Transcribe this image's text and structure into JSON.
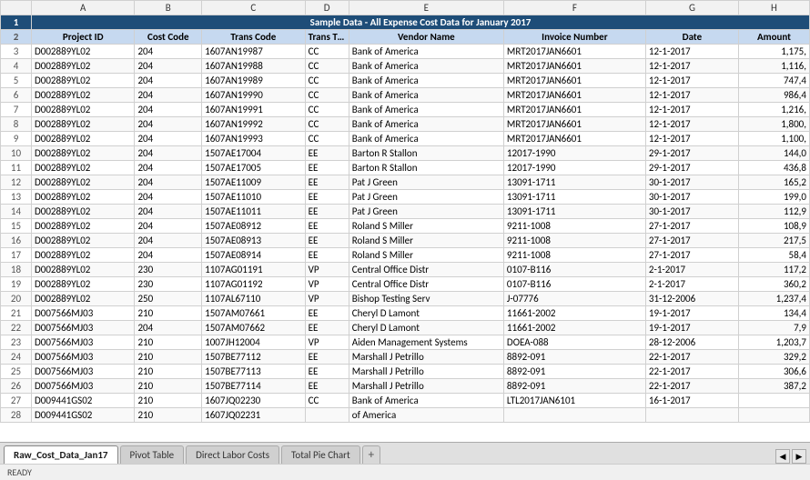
{
  "title": "Sample Data - All Expense Cost Data for January 2017",
  "columns": {
    "row_num": "#",
    "A": "A",
    "B": "B",
    "C": "C",
    "D": "D",
    "E": "E",
    "F": "F",
    "G": "G",
    "H": "H"
  },
  "headers": {
    "A": "Project ID",
    "B": "Cost Code",
    "C": "Trans Code",
    "D": "Trans Type",
    "E": "Vendor Name",
    "F": "Invoice Number",
    "G": "Date",
    "H": "Amount"
  },
  "rows": [
    {
      "row": 3,
      "A": "D002889YL02",
      "B": "204",
      "C": "1607AN19987",
      "D": "CC",
      "E": "Bank of America",
      "F": "MRT2017JAN6601",
      "G": "12-1-2017",
      "H": "1,175,"
    },
    {
      "row": 4,
      "A": "D002889YL02",
      "B": "204",
      "C": "1607AN19988",
      "D": "CC",
      "E": "Bank of America",
      "F": "MRT2017JAN6601",
      "G": "12-1-2017",
      "H": "1,116,"
    },
    {
      "row": 5,
      "A": "D002889YL02",
      "B": "204",
      "C": "1607AN19989",
      "D": "CC",
      "E": "Bank of America",
      "F": "MRT2017JAN6601",
      "G": "12-1-2017",
      "H": "747,4"
    },
    {
      "row": 6,
      "A": "D002889YL02",
      "B": "204",
      "C": "1607AN19990",
      "D": "CC",
      "E": "Bank of America",
      "F": "MRT2017JAN6601",
      "G": "12-1-2017",
      "H": "986,4"
    },
    {
      "row": 7,
      "A": "D002889YL02",
      "B": "204",
      "C": "1607AN19991",
      "D": "CC",
      "E": "Bank of America",
      "F": "MRT2017JAN6601",
      "G": "12-1-2017",
      "H": "1,216,"
    },
    {
      "row": 8,
      "A": "D002889YL02",
      "B": "204",
      "C": "1607AN19992",
      "D": "CC",
      "E": "Bank of America",
      "F": "MRT2017JAN6601",
      "G": "12-1-2017",
      "H": "1,800,"
    },
    {
      "row": 9,
      "A": "D002889YL02",
      "B": "204",
      "C": "1607AN19993",
      "D": "CC",
      "E": "Bank of America",
      "F": "MRT2017JAN6601",
      "G": "12-1-2017",
      "H": "1,100,"
    },
    {
      "row": 10,
      "A": "D002889YL02",
      "B": "204",
      "C": "1507AE17004",
      "D": "EE",
      "E": "Barton R Stallon",
      "F": "12017-1990",
      "G": "29-1-2017",
      "H": "144,0"
    },
    {
      "row": 11,
      "A": "D002889YL02",
      "B": "204",
      "C": "1507AE17005",
      "D": "EE",
      "E": "Barton R Stallon",
      "F": "12017-1990",
      "G": "29-1-2017",
      "H": "436,8"
    },
    {
      "row": 12,
      "A": "D002889YL02",
      "B": "204",
      "C": "1507AE11009",
      "D": "EE",
      "E": "Pat J Green",
      "F": "13091-1711",
      "G": "30-1-2017",
      "H": "165,2"
    },
    {
      "row": 13,
      "A": "D002889YL02",
      "B": "204",
      "C": "1507AE11010",
      "D": "EE",
      "E": "Pat J Green",
      "F": "13091-1711",
      "G": "30-1-2017",
      "H": "199,0"
    },
    {
      "row": 14,
      "A": "D002889YL02",
      "B": "204",
      "C": "1507AE11011",
      "D": "EE",
      "E": "Pat J Green",
      "F": "13091-1711",
      "G": "30-1-2017",
      "H": "112,9"
    },
    {
      "row": 15,
      "A": "D002889YL02",
      "B": "204",
      "C": "1507AE08912",
      "D": "EE",
      "E": "Roland S Miller",
      "F": "9211-1008",
      "G": "27-1-2017",
      "H": "108,9"
    },
    {
      "row": 16,
      "A": "D002889YL02",
      "B": "204",
      "C": "1507AE08913",
      "D": "EE",
      "E": "Roland S Miller",
      "F": "9211-1008",
      "G": "27-1-2017",
      "H": "217,5"
    },
    {
      "row": 17,
      "A": "D002889YL02",
      "B": "204",
      "C": "1507AE08914",
      "D": "EE",
      "E": "Roland S Miller",
      "F": "9211-1008",
      "G": "27-1-2017",
      "H": "58,4"
    },
    {
      "row": 18,
      "A": "D002889YL02",
      "B": "230",
      "C": "1107AG01191",
      "D": "VP",
      "E": "Central Office Distr",
      "F": "0107-B116",
      "G": "2-1-2017",
      "H": "117,2"
    },
    {
      "row": 19,
      "A": "D002889YL02",
      "B": "230",
      "C": "1107AG01192",
      "D": "VP",
      "E": "Central Office Distr",
      "F": "0107-B116",
      "G": "2-1-2017",
      "H": "360,2"
    },
    {
      "row": 20,
      "A": "D002889YL02",
      "B": "250",
      "C": "1107AL67110",
      "D": "VP",
      "E": "Bishop Testing Serv",
      "F": "J-07776",
      "G": "31-12-2006",
      "H": "1,237,4"
    },
    {
      "row": 21,
      "A": "D007566MJ03",
      "B": "210",
      "C": "1507AM07661",
      "D": "EE",
      "E": "Cheryl D Lamont",
      "F": "11661-2002",
      "G": "19-1-2017",
      "H": "134,4"
    },
    {
      "row": 22,
      "A": "D007566MJ03",
      "B": "204",
      "C": "1507AM07662",
      "D": "EE",
      "E": "Cheryl D Lamont",
      "F": "11661-2002",
      "G": "19-1-2017",
      "H": "7,9"
    },
    {
      "row": 23,
      "A": "D007566MJ03",
      "B": "210",
      "C": "1007JH12004",
      "D": "VP",
      "E": "Aiden Management Systems",
      "F": "DOEA-088",
      "G": "28-12-2006",
      "H": "1,203,7"
    },
    {
      "row": 24,
      "A": "D007566MJ03",
      "B": "210",
      "C": "1507BE77112",
      "D": "EE",
      "E": "Marshall J Petrillo",
      "F": "8892-091",
      "G": "22-1-2017",
      "H": "329,2"
    },
    {
      "row": 25,
      "A": "D007566MJ03",
      "B": "210",
      "C": "1507BE77113",
      "D": "EE",
      "E": "Marshall J Petrillo",
      "F": "8892-091",
      "G": "22-1-2017",
      "H": "306,6"
    },
    {
      "row": 26,
      "A": "D007566MJ03",
      "B": "210",
      "C": "1507BE77114",
      "D": "EE",
      "E": "Marshall J Petrillo",
      "F": "8892-091",
      "G": "22-1-2017",
      "H": "387,2"
    },
    {
      "row": 27,
      "A": "D009441GS02",
      "B": "210",
      "C": "1607JQ02230",
      "D": "CC",
      "E": "Bank of America",
      "F": "LTL2017JAN6101",
      "G": "16-1-2017",
      "H": ""
    },
    {
      "row": 28,
      "A": "D009441GS02",
      "B": "210",
      "C": "1607JQ02231",
      "D": "",
      "E": "of America",
      "F": "",
      "G": "",
      "H": ""
    }
  ],
  "tabs": [
    {
      "id": "raw",
      "label": "Raw_Cost_Data_Jan17",
      "active": true
    },
    {
      "id": "pivot",
      "label": "Pivot Table",
      "active": false
    },
    {
      "id": "direct",
      "label": "Direct Labor Costs",
      "active": false
    },
    {
      "id": "pie",
      "label": "Total Pie Chart",
      "active": false
    }
  ],
  "status": "READY",
  "tab_add": "+"
}
